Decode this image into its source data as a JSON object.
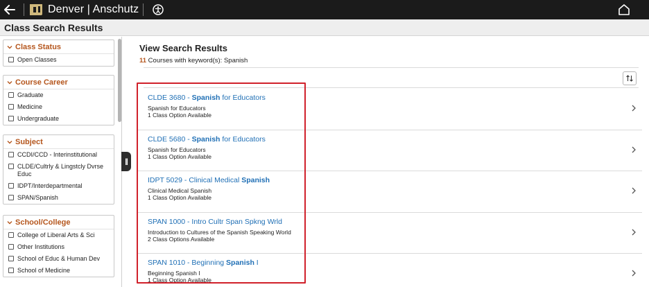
{
  "topbar": {
    "back_icon": "back-arrow-icon",
    "brand": "Denver | Anschutz",
    "accessibility_icon": "accessibility-icon",
    "home_icon": "home-icon"
  },
  "page": {
    "title": "Class Search Results"
  },
  "filters": [
    {
      "title": "Class Status",
      "options": [
        "Open Classes"
      ]
    },
    {
      "title": "Course Career",
      "options": [
        "Graduate",
        "Medicine",
        "Undergraduate"
      ]
    },
    {
      "title": "Subject",
      "options": [
        "CCDI/CCD - Interinstitutional",
        "CLDE/Cultrly & Lingstcly Dvrse Educ",
        "IDPT/Interdepartmental",
        "SPAN/Spanish"
      ]
    },
    {
      "title": "School/College",
      "options": [
        "College of Liberal Arts & Sci",
        "Other Institutions",
        "School of Educ & Human Dev",
        "School of Medicine"
      ]
    }
  ],
  "main": {
    "title": "View Search Results",
    "count": "11",
    "count_text": " Courses with keyword(s): Spanish",
    "results": [
      {
        "title_pre": "CLDE 3680 - ",
        "title_bold": "Spanish",
        "title_post": " for Educators",
        "subtitle": "Spanish for Educators",
        "options": "1 Class Option Available"
      },
      {
        "title_pre": "CLDE 5680 - ",
        "title_bold": "Spanish",
        "title_post": " for Educators",
        "subtitle": "Spanish for Educators",
        "options": "1 Class Option Available"
      },
      {
        "title_pre": "IDPT 5029 - Clinical Medical ",
        "title_bold": "Spanish",
        "title_post": "",
        "subtitle": "Clinical Medical Spanish",
        "options": "1 Class Option Available"
      },
      {
        "title_pre": "SPAN 1000 - Intro Cultr Span Spkng Wrld",
        "title_bold": "",
        "title_post": "",
        "subtitle": "Introduction to Cultures of the Spanish Speaking World",
        "options": "2 Class Options Available"
      },
      {
        "title_pre": "SPAN 1010 - Beginning ",
        "title_bold": "Spanish",
        "title_post": " I",
        "subtitle": "Beginning Spanish I",
        "options": "1 Class Option Available"
      }
    ]
  },
  "colors": {
    "accent": "#b5561d",
    "link": "#1f6fb5",
    "highlight": "#d0202a",
    "topbar": "#1b1b1b"
  }
}
